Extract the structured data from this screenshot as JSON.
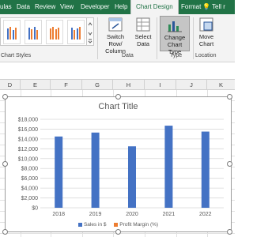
{
  "ribbon": {
    "tabs": [
      "ulas",
      "Data",
      "Review",
      "View",
      "Developer",
      "Help",
      "Chart Design",
      "Format",
      "Tell r"
    ],
    "active_tab": "Chart Design",
    "groups": {
      "chart_styles": "Chart Styles",
      "data": "Data",
      "type": "Type",
      "location": "Location"
    },
    "buttons": {
      "switch_row_column": [
        "Switch Row/",
        "Column"
      ],
      "select_data": [
        "Select",
        "Data"
      ],
      "change_chart_type": [
        "Change",
        "Chart Type"
      ],
      "move_chart": [
        "Move",
        "Chart"
      ]
    }
  },
  "columns": [
    "D",
    "E",
    "F",
    "G",
    "H",
    "I",
    "J",
    "K"
  ],
  "chart_data": {
    "type": "bar",
    "title": "Chart Title",
    "categories": [
      "2018",
      "2019",
      "2020",
      "2021",
      "2022"
    ],
    "series": [
      {
        "name": "Sales in $",
        "values": [
          14500,
          15300,
          12500,
          16700,
          15500
        ],
        "color": "#4472c4"
      },
      {
        "name": "Profit Margin (%)",
        "values": [
          0,
          0,
          0,
          0,
          0
        ],
        "color": "#ed7d31"
      }
    ],
    "y_ticks": [
      "$0",
      "$2,000",
      "$4,000",
      "$6,000",
      "$8,000",
      "$10,000",
      "$12,000",
      "$14,000",
      "$16,000",
      "$18,000"
    ],
    "ylim": [
      0,
      18000
    ],
    "grid": true,
    "legend_position": "bottom"
  },
  "colors": {
    "ribbon_tab_bg": "#217346",
    "bar_blue": "#4472c4",
    "bar_orange": "#ed7d31",
    "text_gray": "#595959"
  }
}
